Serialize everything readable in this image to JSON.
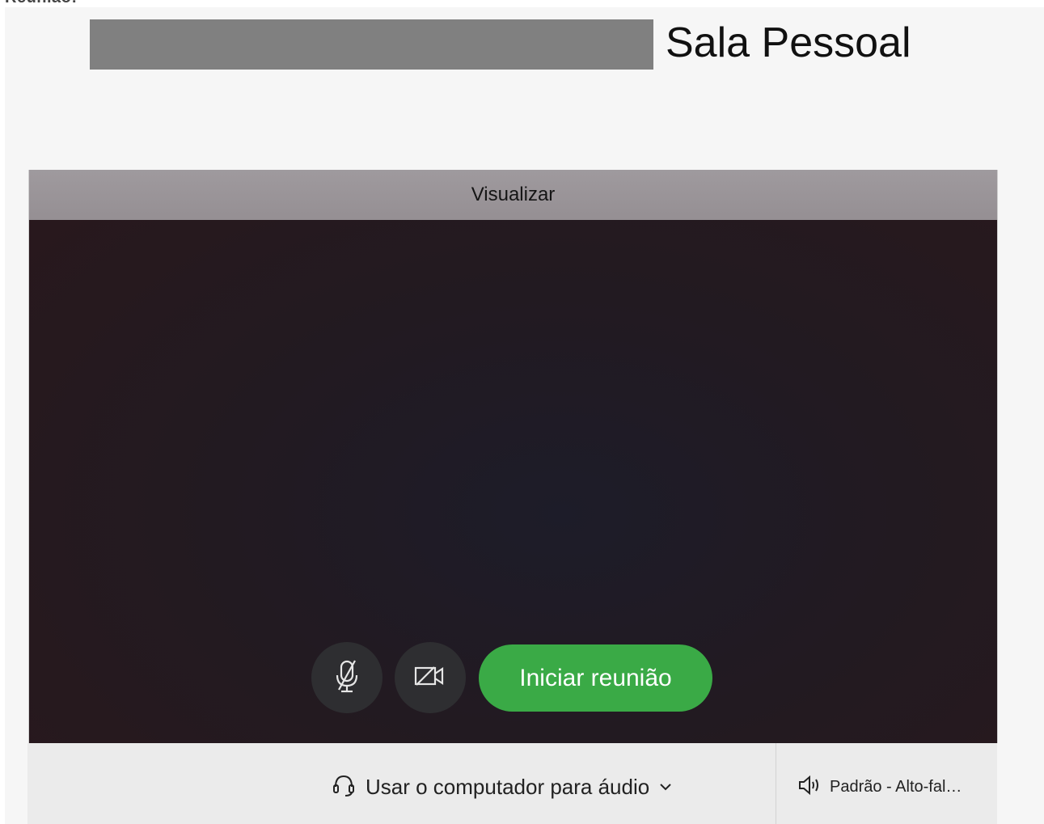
{
  "page_top_text": "Reunião:",
  "room": {
    "title": "Sala Pessoal"
  },
  "preview": {
    "header": "Visualizar"
  },
  "controls": {
    "mic_icon": "microphone-muted-icon",
    "camera_icon": "camera-off-icon",
    "start_button": "Iniciar reunião",
    "start_color": "#3aaa46"
  },
  "audio": {
    "icon": "headset-icon",
    "label": "Usar o computador para áudio",
    "dropdown_icon": "chevron-down-icon"
  },
  "speaker": {
    "icon": "speaker-icon",
    "label": "Padrão - Alto-fal…"
  }
}
